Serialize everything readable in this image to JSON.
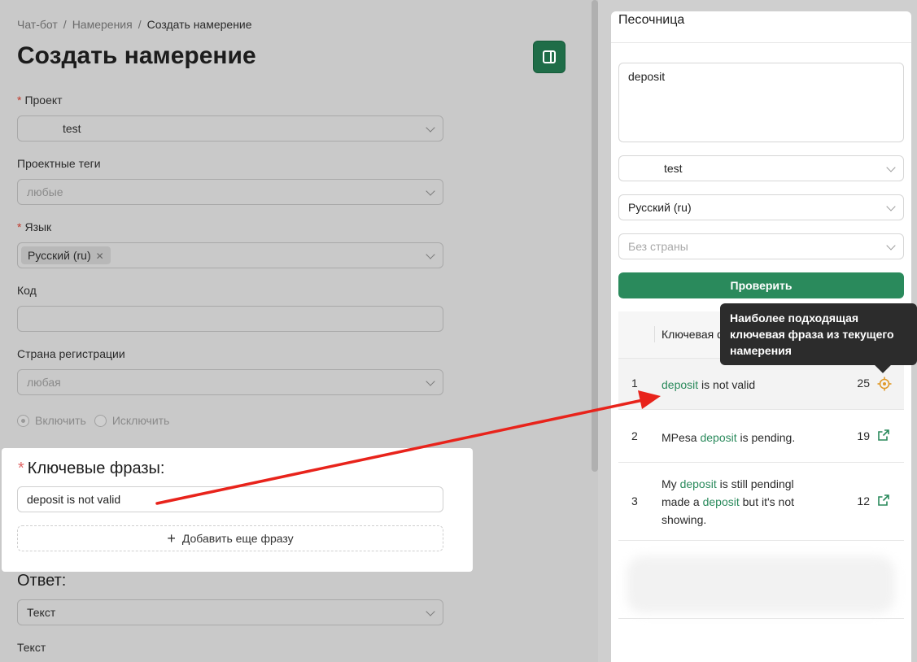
{
  "breadcrumb": {
    "items": [
      "Чат-бот",
      "Намерения"
    ],
    "current": "Создать намерение",
    "separator": "/"
  },
  "page_title": "Создать намерение",
  "form": {
    "project": {
      "label": "Проект",
      "value": "test"
    },
    "project_tags": {
      "label": "Проектные теги",
      "placeholder": "любые"
    },
    "language": {
      "label": "Язык",
      "tag": "Русский (ru)"
    },
    "code": {
      "label": "Код",
      "value": ""
    },
    "country": {
      "label": "Страна регистрации",
      "placeholder": "любая"
    },
    "include_label": "Включить",
    "exclude_label": "Исключить",
    "answer_heading": "Ответ:",
    "answer_type": "Текст",
    "text_label": "Текст"
  },
  "phrases_card": {
    "title": "Ключевые фразы:",
    "phrase_value": "deposit is not valid",
    "add_label": "Добавить еще фразу"
  },
  "sandbox": {
    "title": "Песочница",
    "query": "deposit",
    "project": "test",
    "language": "Русский (ru)",
    "country_placeholder": "Без страны",
    "check_label": "Проверить",
    "table_header": "Ключевая ф",
    "rows": [
      {
        "n": "1",
        "pre": "",
        "kw": "deposit",
        "post": " is not valid",
        "score": "25"
      },
      {
        "n": "2",
        "pre": "MPesa ",
        "kw": "deposit",
        "post": " is pending.",
        "score": "19"
      },
      {
        "n": "3",
        "line1_pre": "My ",
        "line1_kw": "deposit",
        "line1_post": " is still pendingl",
        "line2_pre": "made a ",
        "line2_kw": "deposit",
        "line2_post": " but it's not showing.",
        "score": "12"
      }
    ]
  },
  "tooltip": "Наиболее подходящая ключевая фраза из текущего намерения",
  "colors": {
    "accent": "#2a8a5c",
    "arrow": "#e8231b",
    "target": "#e09a2a",
    "required": "#e06666"
  }
}
